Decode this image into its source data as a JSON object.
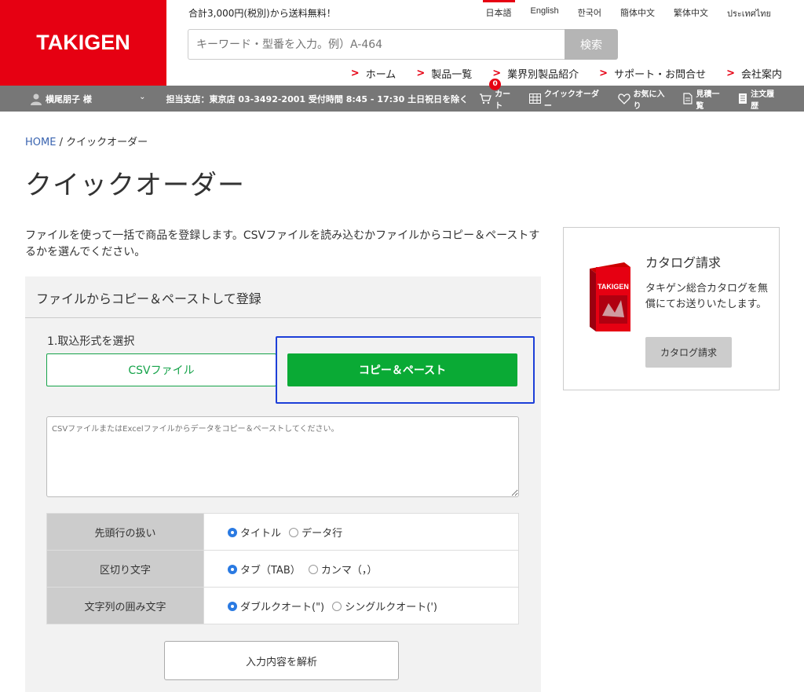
{
  "header": {
    "logo": "TAKIGEN",
    "shipping_note": "合計3,000円(税別)から送料無料！",
    "languages": [
      "日本語",
      "English",
      "한국어",
      "簡体中文",
      "繁体中文",
      "ประเทศไทย"
    ],
    "active_language": "日本語",
    "search_placeholder": "キーワード・型番を入力。例）A-464",
    "search_button": "検索",
    "nav": [
      "ホーム",
      "製品一覧",
      "業界別製品紹介",
      "サポート・お問合せ",
      "会社案内"
    ]
  },
  "subbar": {
    "user_name": "横尾朋子 様",
    "branch_info": "担当支店：東京店 03-3492-2001 受付時間 8:45 - 17:30 土日祝日を除く",
    "cart_label": "カート",
    "cart_count": "0",
    "quick_order": "クイックオーダー",
    "favorites": "お気に入り",
    "quotes": "見積一覧",
    "order_history": "注文履歴"
  },
  "breadcrumb": {
    "home": "HOME",
    "separator": "/",
    "current": "クイックオーダー"
  },
  "page_title": "クイックオーダー",
  "intro": "ファイルを使って一括で商品を登録します。CSVファイルを読み込むかファイルからコピー＆ペーストするかを選んでください。",
  "panel": {
    "heading": "ファイルからコピー＆ペーストして登録",
    "step_label": "1.取込形式を選択",
    "option_csv": "CSVファイル",
    "option_paste": "コピー＆ペースト",
    "paste_placeholder": "CSVファイルまたはExcelファイルからデータをコピー＆ペーストしてください。",
    "options": [
      {
        "label": "先頭行の扱い",
        "choices": [
          {
            "text": "タイトル",
            "selected": true
          },
          {
            "text": "データ行",
            "selected": false
          }
        ]
      },
      {
        "label": "区切り文字",
        "choices": [
          {
            "text": "タブ（TAB）",
            "selected": true
          },
          {
            "text": "カンマ（，）",
            "selected": false
          }
        ]
      },
      {
        "label": "文字列の囲み文字",
        "choices": [
          {
            "text": "ダブルクオート(\")",
            "selected": true
          },
          {
            "text": "シングルクオート(')",
            "selected": false
          }
        ]
      }
    ],
    "parse_button": "入力内容を解析"
  },
  "catalog": {
    "title": "カタログ請求",
    "description": "タキゲン総合カタログを無償にてお送りいたします。",
    "button": "カタログ請求",
    "cover_text": "TAKIGEN"
  },
  "colors": {
    "brand": "#e60012",
    "accent_green": "#0aaa35",
    "focus_blue": "#1d3fd8"
  }
}
